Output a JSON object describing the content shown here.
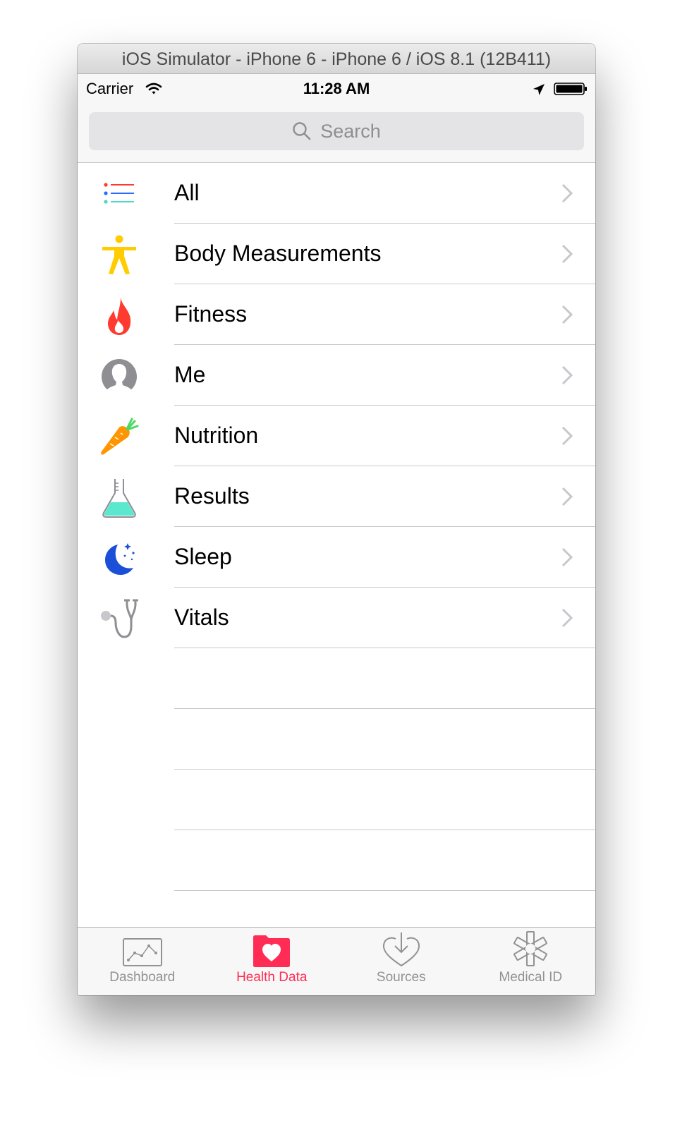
{
  "window": {
    "title": "iOS Simulator - iPhone 6 - iPhone 6 / iOS 8.1 (12B411)"
  },
  "status": {
    "carrier": "Carrier",
    "time": "11:28 AM"
  },
  "search": {
    "placeholder": "Search"
  },
  "categories": [
    {
      "label": "All",
      "icon": "list-icon"
    },
    {
      "label": "Body Measurements",
      "icon": "body-figure-icon"
    },
    {
      "label": "Fitness",
      "icon": "flame-icon"
    },
    {
      "label": "Me",
      "icon": "person-icon"
    },
    {
      "label": "Nutrition",
      "icon": "carrot-icon"
    },
    {
      "label": "Results",
      "icon": "flask-icon"
    },
    {
      "label": "Sleep",
      "icon": "moon-icon"
    },
    {
      "label": "Vitals",
      "icon": "stethoscope-icon"
    }
  ],
  "tabs": [
    {
      "label": "Dashboard",
      "icon": "dashboard-icon",
      "active": false
    },
    {
      "label": "Health Data",
      "icon": "health-data-icon",
      "active": true
    },
    {
      "label": "Sources",
      "icon": "sources-icon",
      "active": false
    },
    {
      "label": "Medical ID",
      "icon": "medical-id-icon",
      "active": false
    }
  ],
  "colors": {
    "accent": "#ff2d55",
    "separator": "#c8c7cc",
    "tab_inactive": "#929292"
  }
}
